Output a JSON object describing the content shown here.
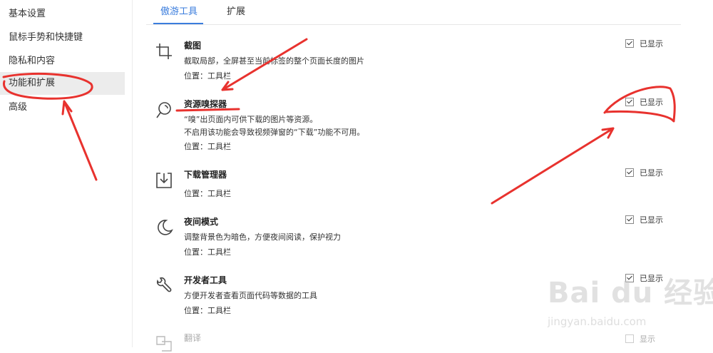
{
  "sidebar": {
    "items": [
      {
        "label": "基本设置"
      },
      {
        "label": "鼠标手势和快捷键"
      },
      {
        "label": "隐私和内容"
      },
      {
        "label": "功能和扩展"
      },
      {
        "label": "高级"
      }
    ]
  },
  "tabs": [
    {
      "label": "傲游工具"
    },
    {
      "label": "扩展"
    }
  ],
  "features": [
    {
      "title": "截图",
      "desc1": "截取局部，全屏甚至当前标签的整个页面长度的图片",
      "desc2": "",
      "location": "位置：工具栏",
      "check_label": "已显示",
      "icon": "crop-icon"
    },
    {
      "title": "资源嗅探器",
      "desc1": "“嗅”出页面内可供下载的图片等资源。",
      "desc2": "不启用该功能会导致视频弹窗的“下载”功能不可用。",
      "location": "位置：工具栏",
      "check_label": "已显示",
      "icon": "sniffer-icon"
    },
    {
      "title": "下载管理器",
      "desc1": "",
      "desc2": "",
      "location": "位置：工具栏",
      "check_label": "已显示",
      "icon": "download-icon"
    },
    {
      "title": "夜间模式",
      "desc1": "调整背景色为暗色，方便夜间阅读，保护视力",
      "desc2": "",
      "location": "位置：工具栏",
      "check_label": "已显示",
      "icon": "moon-icon"
    },
    {
      "title": "开发者工具",
      "desc1": "方便开发者查看页面代码等数据的工具",
      "desc2": "",
      "location": "位置：工具栏",
      "check_label": "已显示",
      "icon": "wrench-icon"
    },
    {
      "title": "翻译",
      "desc1": "",
      "desc2": "",
      "location": "",
      "check_label": "显示",
      "icon": "translate-icon"
    }
  ],
  "watermark": {
    "main": "Bai du 经验",
    "sub": "jingyan.baidu.com"
  },
  "colors": {
    "accent": "#3b7ddd",
    "annotation": "#e8322e"
  }
}
